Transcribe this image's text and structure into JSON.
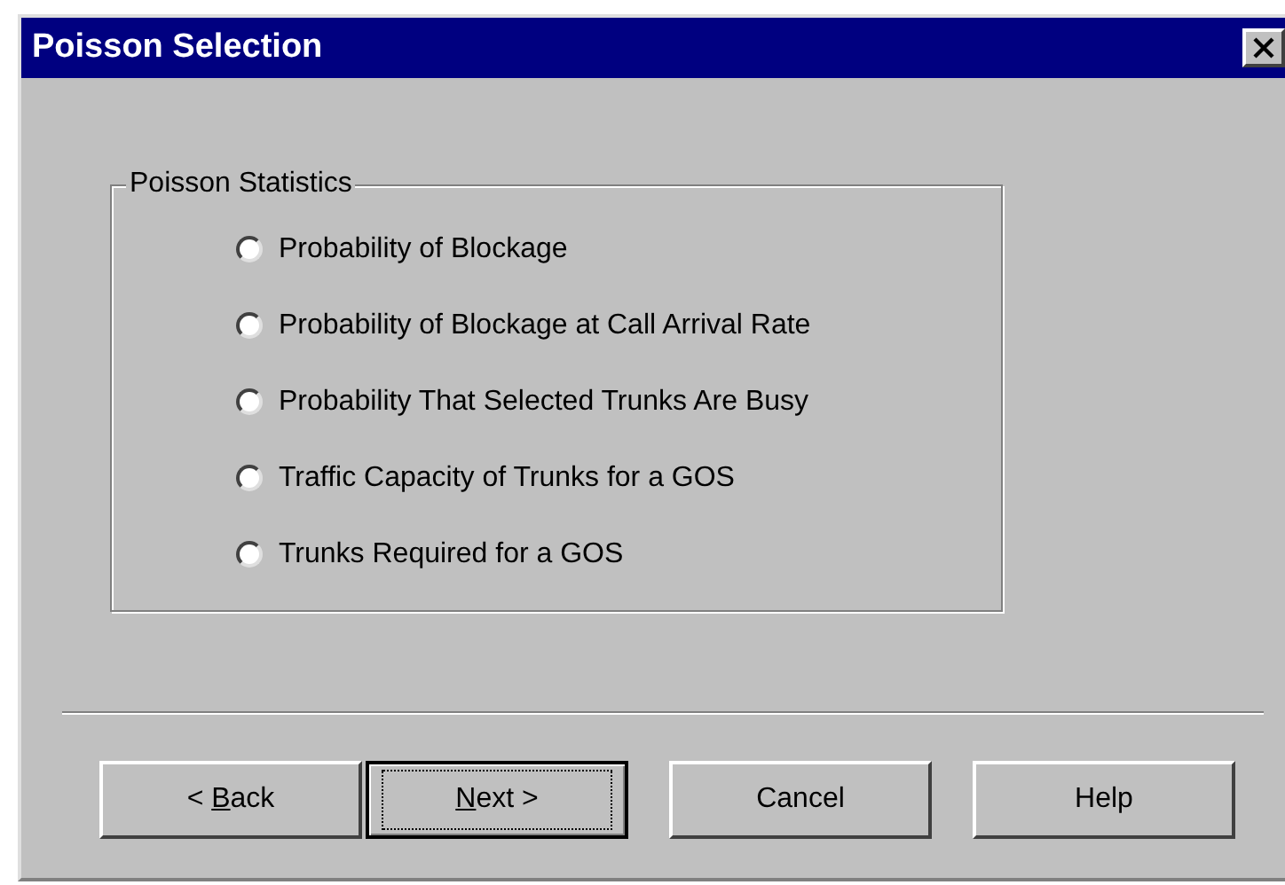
{
  "window": {
    "title": "Poisson Selection"
  },
  "group": {
    "title": "Poisson Statistics",
    "options": [
      {
        "label": "Probability of Blockage",
        "selected": false
      },
      {
        "label": "Probability of Blockage at Call Arrival Rate",
        "selected": false
      },
      {
        "label": "Probability That Selected Trunks Are Busy",
        "selected": false
      },
      {
        "label": "Traffic Capacity of Trunks for a GOS",
        "selected": false
      },
      {
        "label": "Trunks Required for a GOS",
        "selected": false
      }
    ]
  },
  "buttons": [
    {
      "before": "< ",
      "key": "B",
      "after": "ack",
      "default": false
    },
    {
      "key": "N",
      "after": "ext >",
      "default": true
    },
    {
      "before": "Cancel",
      "default": false
    },
    {
      "before": "Help",
      "default": false
    }
  ]
}
